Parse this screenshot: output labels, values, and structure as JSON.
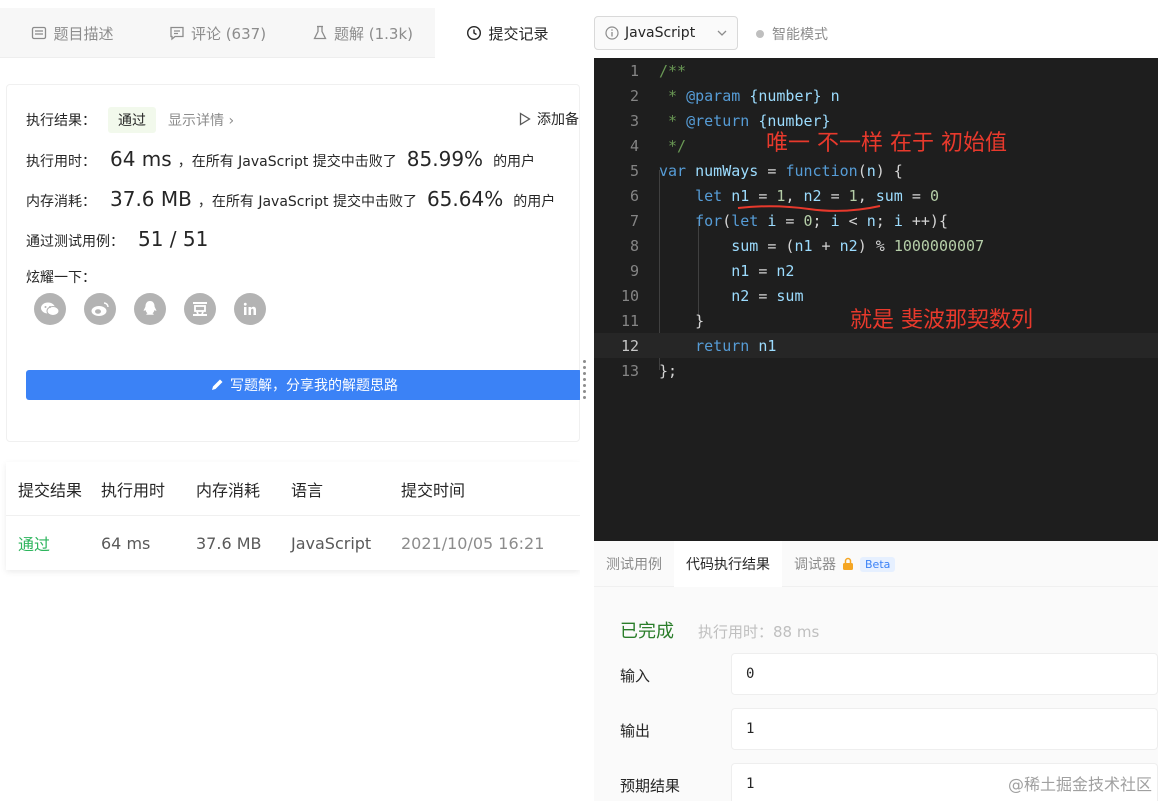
{
  "left": {
    "tabs": [
      {
        "label": "题目描述",
        "icon": "description-icon"
      },
      {
        "label": "评论 (637)",
        "icon": "comment-icon"
      },
      {
        "label": "题解 (1.3k)",
        "icon": "flask-icon"
      },
      {
        "label": "提交记录",
        "icon": "clock-icon"
      }
    ],
    "active_tab": 3,
    "result": {
      "label_result": "执行结果：",
      "status": "通过",
      "detail_link": "显示详情 ›",
      "add_note": "添加备",
      "time_label": "执行用时：",
      "time_value": "64 ms",
      "time_mid": "，在所有 JavaScript 提交中击败了",
      "time_pct": "85.99%",
      "time_suffix": "的用户",
      "mem_label": "内存消耗：",
      "mem_value": "37.6 MB",
      "mem_mid": "，在所有 JavaScript 提交中击败了",
      "mem_pct": "65.64%",
      "mem_suffix": "的用户",
      "cases_label": "通过测试用例：",
      "cases_value": "51 / 51",
      "share_label": "炫耀一下：",
      "share_icons": [
        "wechat-icon",
        "weibo-icon",
        "qq-icon",
        "douban-icon",
        "linkedin-icon"
      ],
      "write_button": "写题解，分享我的解题思路"
    },
    "table": {
      "headers": [
        "提交结果",
        "执行用时",
        "内存消耗",
        "语言",
        "提交时间"
      ],
      "rows": [
        [
          "通过",
          "64 ms",
          "37.6 MB",
          "JavaScript",
          "2021/10/05 16:21"
        ]
      ]
    }
  },
  "right": {
    "language": "JavaScript",
    "smart_mode": "智能模式",
    "code_lines": [
      "1",
      "2",
      "3",
      "4",
      "5",
      "6",
      "7",
      "8",
      "9",
      "10",
      "11",
      "12",
      "13"
    ],
    "current_line": 12,
    "annotations": {
      "a1": "唯一 不一样 在于 初始值",
      "a2": "就是 斐波那契数列"
    },
    "console_tabs": [
      "测试用例",
      "代码执行结果",
      "调试器"
    ],
    "beta": "Beta",
    "active_console_tab": 1,
    "status": "已完成",
    "exec_time": "执行用时：88 ms",
    "io": [
      {
        "label": "输入",
        "value": "0"
      },
      {
        "label": "输出",
        "value": "1"
      },
      {
        "label": "预期结果",
        "value": "1"
      }
    ],
    "watermark": "@稀土掘金技术社区"
  },
  "colors": {
    "accent": "#3b82f6",
    "pass": "#2db55d",
    "editor_bg": "#1e1e1e",
    "annotation": "#e8392c"
  }
}
